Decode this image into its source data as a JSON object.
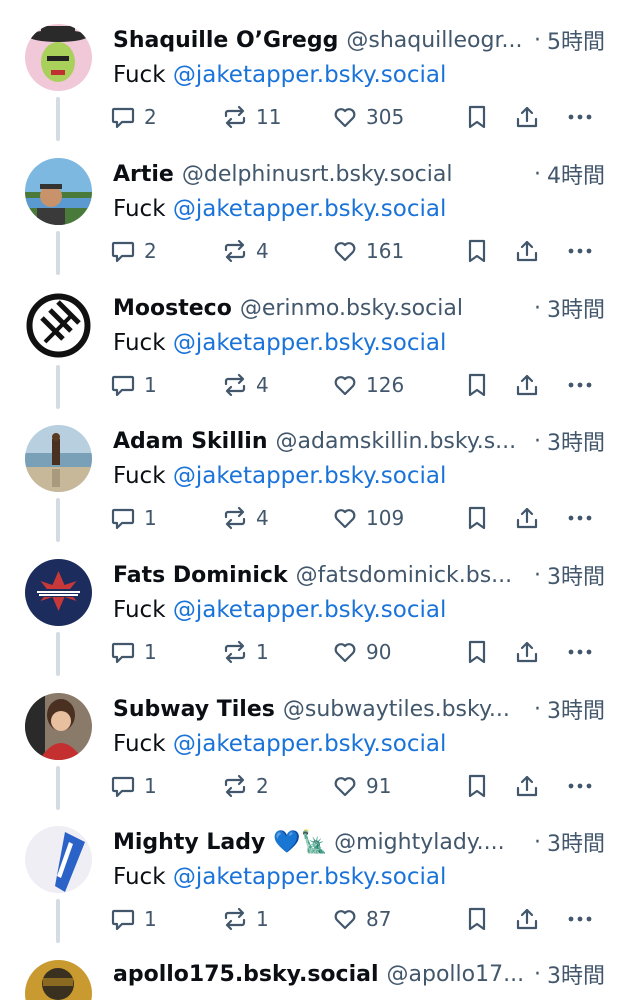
{
  "mention_prefix": "Fuck ",
  "posts": [
    {
      "name": "Shaquille O’Gregg",
      "emoji": "",
      "handle": "@shaquilleogr...",
      "time": "5時間",
      "mention": "@jaketapper.bsky.social",
      "replies": "2",
      "reposts": "11",
      "likes": "305",
      "avatar_color": "#a8d05a"
    },
    {
      "name": "Artie",
      "emoji": "",
      "handle": "@delphinusrt.bsky.social",
      "time": "4時間",
      "mention": "@jaketapper.bsky.social",
      "replies": "2",
      "reposts": "4",
      "likes": "161",
      "avatar_color": "#5a8fc0"
    },
    {
      "name": "Moosteco",
      "emoji": "",
      "handle": "@erinmo.bsky.social",
      "time": "3時間",
      "mention": "@jaketapper.bsky.social",
      "replies": "1",
      "reposts": "4",
      "likes": "126",
      "avatar_color": "#111111"
    },
    {
      "name": "Adam Skillin",
      "emoji": "",
      "handle": "@adamskillin.bsky.s...",
      "time": "3時間",
      "mention": "@jaketapper.bsky.social",
      "replies": "1",
      "reposts": "4",
      "likes": "109",
      "avatar_color": "#b8c8d4"
    },
    {
      "name": "Fats Dominick",
      "emoji": "",
      "handle": "@fatsdominick.bs...",
      "time": "3時間",
      "mention": "@jaketapper.bsky.social",
      "replies": "1",
      "reposts": "1",
      "likes": "90",
      "avatar_color": "#1c2c5c"
    },
    {
      "name": "Subway Tiles",
      "emoji": "",
      "handle": "@subwaytiles.bsky...",
      "time": "3時間",
      "mention": "@jaketapper.bsky.social",
      "replies": "1",
      "reposts": "2",
      "likes": "91",
      "avatar_color": "#c43030"
    },
    {
      "name": "Mighty Lady",
      "emoji": "💙🗽",
      "handle": "@mightylady....",
      "time": "3時間",
      "mention": "@jaketapper.bsky.social",
      "replies": "1",
      "reposts": "1",
      "likes": "87",
      "avatar_color": "#2a62c8"
    },
    {
      "name": "apollo175.bsky.social",
      "emoji": "",
      "handle": "@apollo17...",
      "time": "3時間",
      "mention": "",
      "replies": "",
      "reposts": "",
      "likes": "",
      "avatar_color": "#c89a30"
    }
  ],
  "dot": "·"
}
